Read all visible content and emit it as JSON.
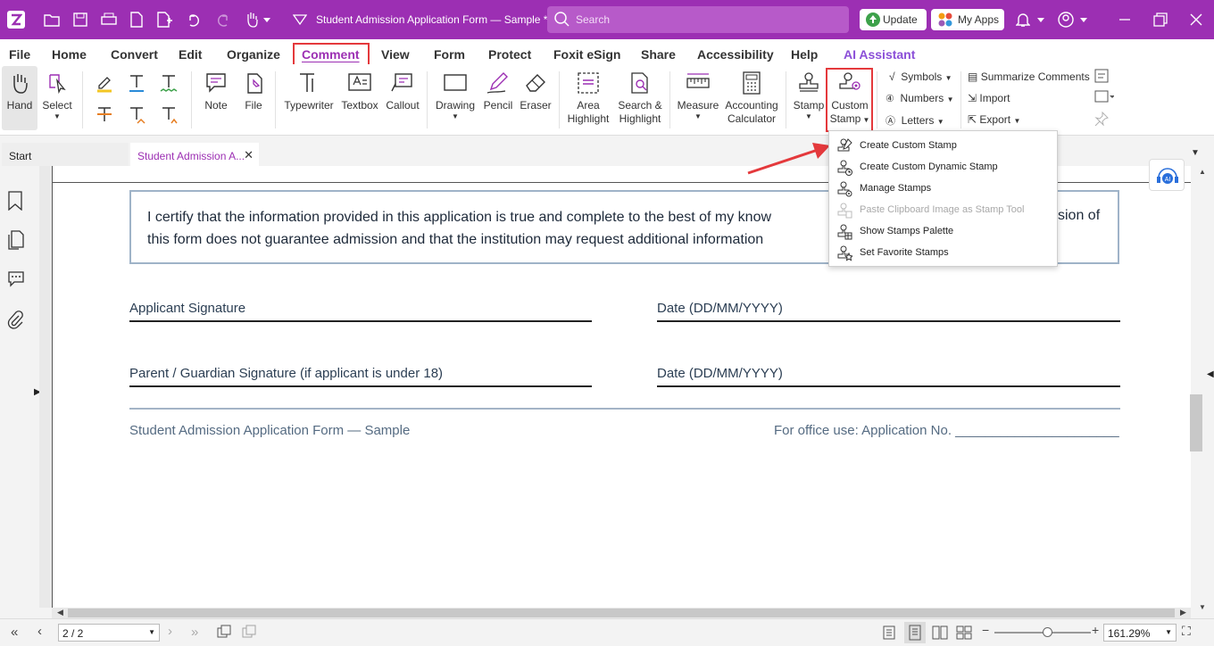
{
  "titlebar": {
    "title": "Student Admission Application Form — Sample *",
    "search_placeholder": "Search",
    "update_label": "Update",
    "myapps_label": "My Apps",
    "bg_color": "#9c2fb3"
  },
  "menubar": {
    "items": [
      "File",
      "Home",
      "Convert",
      "Edit",
      "Organize",
      "Comment",
      "View",
      "Form",
      "Protect",
      "Foxit eSign",
      "Share",
      "Accessibility",
      "Help",
      "AI Assistant"
    ],
    "active": "Comment"
  },
  "ribbon": {
    "hand": "Hand",
    "select": "Select",
    "note": "Note",
    "file": "File",
    "typewriter": "Typewriter",
    "textbox": "Textbox",
    "callout": "Callout",
    "drawing": "Drawing",
    "pencil": "Pencil",
    "eraser": "Eraser",
    "area_highlight_1": "Area",
    "area_highlight_2": "Highlight",
    "search_highlight_1": "Search &",
    "search_highlight_2": "Highlight",
    "measure": "Measure",
    "accounting_1": "Accounting",
    "accounting_2": "Calculator",
    "stamp": "Stamp",
    "custom_stamp_1": "Custom",
    "custom_stamp_2": "Stamp",
    "symbols": "Symbols",
    "numbers": "Numbers",
    "letters": "Letters",
    "summarize": "Summarize Comments",
    "import": "Import",
    "export": "Export"
  },
  "tabs": {
    "start": "Start",
    "doc": "Student Admission A..."
  },
  "document": {
    "certify_line1": "I certify that the information provided in this application is true and complete to the best of my know",
    "certify_line1_tail": "sion of",
    "certify_line2": "this form does not guarantee admission and that the institution may request additional information",
    "applicant_signature": "Applicant Signature",
    "date1": "Date (DD/MM/YYYY)",
    "parent_signature": "Parent / Guardian Signature (if applicant is under 18)",
    "date2": "Date (DD/MM/YYYY)",
    "footer_left": "Student Admission Application Form — Sample",
    "footer_right": "For office use: Application No. ______________________"
  },
  "dropdown": {
    "items": [
      {
        "label": "Create Custom Stamp",
        "enabled": true
      },
      {
        "label": "Create Custom Dynamic Stamp",
        "enabled": true
      },
      {
        "label": "Manage Stamps",
        "enabled": true
      },
      {
        "label": "Paste Clipboard Image as Stamp Tool",
        "enabled": false
      },
      {
        "label": "Show Stamps Palette",
        "enabled": true
      },
      {
        "label": "Set Favorite Stamps",
        "enabled": true
      }
    ]
  },
  "statusbar": {
    "page": "2 / 2",
    "zoom": "161.29%"
  }
}
